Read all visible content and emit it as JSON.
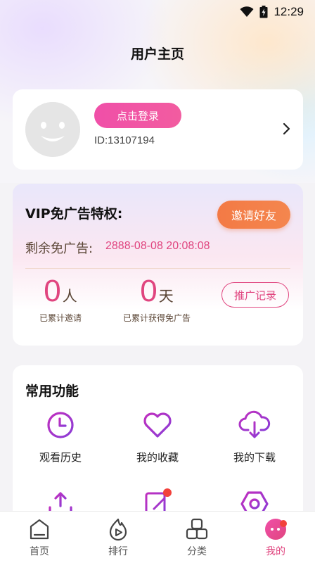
{
  "status": {
    "time": "12:29"
  },
  "page_title": "用户主页",
  "profile": {
    "login_label": "点击登录",
    "user_id": "ID:13107194"
  },
  "vip": {
    "title": "VIP免广告特权:",
    "invite_label": "邀请好友",
    "remain_label": "剩余免广告:",
    "remain_value": "2888-08-08 20:08:08",
    "invites": {
      "num": "0",
      "unit": "人",
      "label": "已累计邀请"
    },
    "days": {
      "num": "0",
      "unit": "天",
      "label": "已累计获得免广告"
    },
    "record_label": "推广记录"
  },
  "functions": {
    "title": "常用功能",
    "items": [
      {
        "label": "观看历史",
        "icon": "clock-icon"
      },
      {
        "label": "我的收藏",
        "icon": "heart-icon"
      },
      {
        "label": "我的下载",
        "icon": "cloud-download-icon"
      },
      {
        "label": "",
        "icon": "upload-icon"
      },
      {
        "label": "",
        "icon": "edit-icon"
      },
      {
        "label": "",
        "icon": "settings-icon"
      }
    ]
  },
  "tabs": [
    {
      "label": "首页",
      "icon": "home-icon"
    },
    {
      "label": "排行",
      "icon": "fire-play-icon"
    },
    {
      "label": "分类",
      "icon": "category-icon"
    },
    {
      "label": "我的",
      "icon": "profile-icon",
      "active": true
    }
  ],
  "colors": {
    "accent_pink": "#e0457f",
    "button_pink": "#f04fa8",
    "invite_orange": "#f37a45",
    "icon_purple": "#b03ac6"
  }
}
